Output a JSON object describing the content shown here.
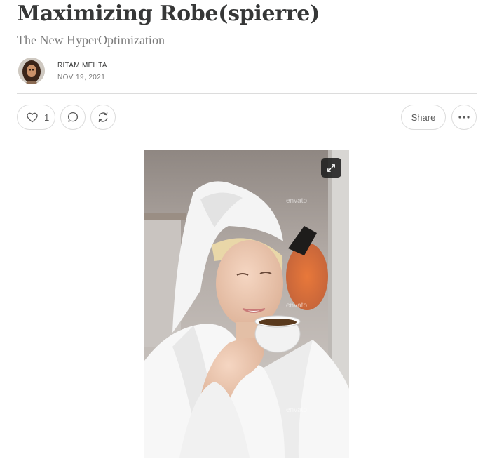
{
  "post": {
    "title": "Maximizing Robe(spierre)",
    "subtitle": "The New HyperOptimization",
    "author": "RITAM MEHTA",
    "date": "NOV 19, 2021"
  },
  "actions": {
    "like_count": "1",
    "share_label": "Share"
  },
  "image": {
    "watermark": "envato"
  }
}
